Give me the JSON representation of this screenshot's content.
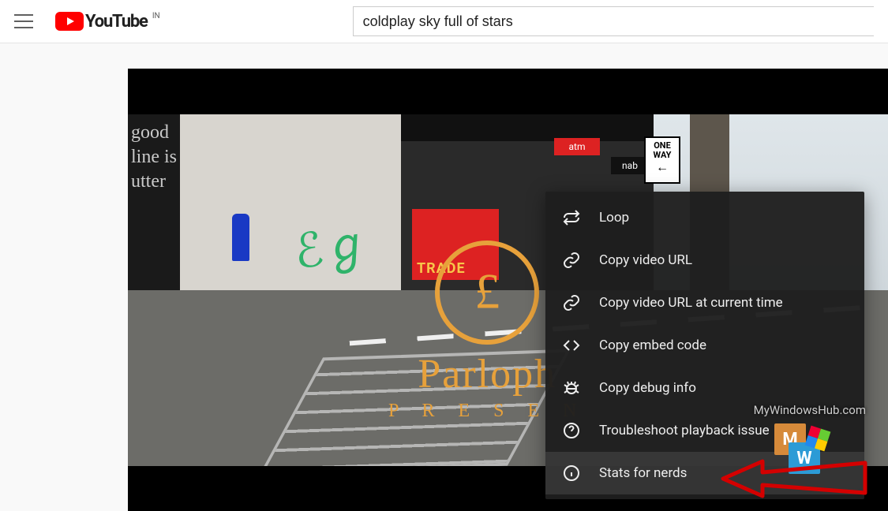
{
  "header": {
    "logo_text": "YouTube",
    "country_code": "IN",
    "search_value": "coldplay sky full of stars"
  },
  "video_scene": {
    "chalk_text": "good\nline\nis\nutter",
    "trade_label": "TRADE",
    "atm_label": "atm",
    "nab_label": "nab",
    "sign_line1": "ONE",
    "sign_line2": "WAY",
    "parlo_big": "Parloph",
    "parlo_small": "P R E S E N"
  },
  "context_menu": {
    "items": [
      {
        "id": "loop",
        "label": "Loop",
        "icon": "loop-icon"
      },
      {
        "id": "copy-url",
        "label": "Copy video URL",
        "icon": "link-icon"
      },
      {
        "id": "copy-url-time",
        "label": "Copy video URL at current time",
        "icon": "link-icon"
      },
      {
        "id": "copy-embed",
        "label": "Copy embed code",
        "icon": "code-icon"
      },
      {
        "id": "copy-debug",
        "label": "Copy debug info",
        "icon": "bug-icon"
      },
      {
        "id": "troubleshoot",
        "label": "Troubleshoot playback issue",
        "icon": "help-icon"
      },
      {
        "id": "stats-nerds",
        "label": "Stats for nerds",
        "icon": "info-icon",
        "highlighted": true
      }
    ]
  },
  "watermark": {
    "text": "MyWindowsHub.com",
    "tile_m": "M",
    "tile_w": "W"
  }
}
